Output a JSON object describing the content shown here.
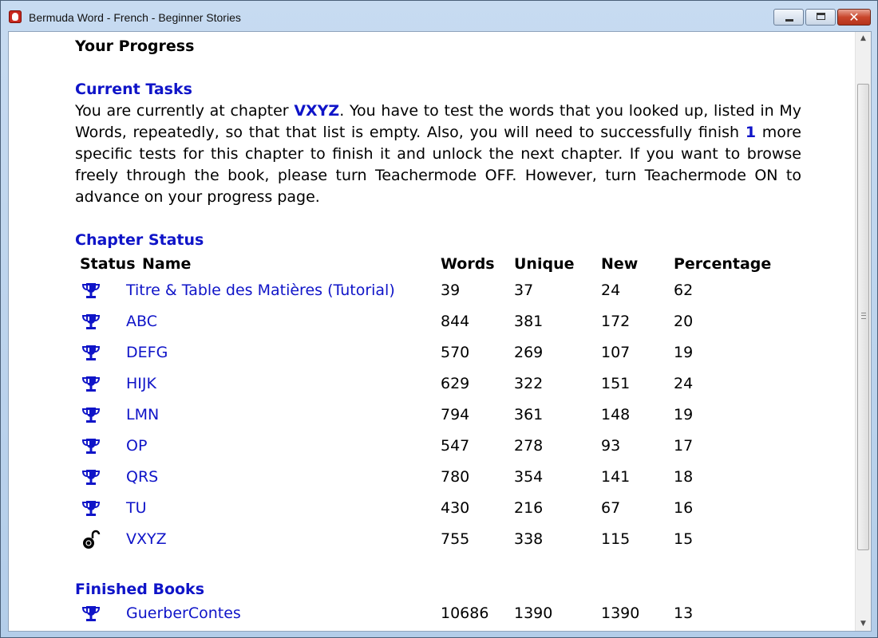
{
  "window": {
    "title": "Bermuda Word - French - Beginner Stories",
    "controls": {
      "minimize": "minimize",
      "maximize": "maximize",
      "close": "✕"
    }
  },
  "page": {
    "title": "Your Progress",
    "current_tasks": {
      "heading": "Current Tasks",
      "text_1": "You are currently at chapter ",
      "chapter": "VXYZ",
      "text_2": ". You have to test the words that you looked up, listed in My Words, repeatedly, so that that list is empty. Also, you will need to successfully finish ",
      "tests_remaining": "1",
      "text_3": " more specific tests for this chapter to finish it and unlock the next chapter. If you want to browse freely through the book, please turn Teachermode OFF. However, turn Teachermode ON to advance on your progress page."
    },
    "chapter_status": {
      "heading": "Chapter Status",
      "columns": {
        "status": "Status",
        "name": "Name",
        "words": "Words",
        "unique": "Unique",
        "new": "New",
        "percentage": "Percentage"
      },
      "rows": [
        {
          "status_icon": "trophy-icon",
          "name": "Titre & Table des Matières (Tutorial)",
          "words": "39",
          "unique": "37",
          "new": "24",
          "percentage": "62"
        },
        {
          "status_icon": "trophy-icon",
          "name": "ABC",
          "words": "844",
          "unique": "381",
          "new": "172",
          "percentage": "20"
        },
        {
          "status_icon": "trophy-icon",
          "name": "DEFG",
          "words": "570",
          "unique": "269",
          "new": "107",
          "percentage": "19"
        },
        {
          "status_icon": "trophy-icon",
          "name": "HIJK",
          "words": "629",
          "unique": "322",
          "new": "151",
          "percentage": "24"
        },
        {
          "status_icon": "trophy-icon",
          "name": "LMN",
          "words": "794",
          "unique": "361",
          "new": "148",
          "percentage": "19"
        },
        {
          "status_icon": "trophy-icon",
          "name": "OP",
          "words": "547",
          "unique": "278",
          "new": "93",
          "percentage": "17"
        },
        {
          "status_icon": "trophy-icon",
          "name": "QRS",
          "words": "780",
          "unique": "354",
          "new": "141",
          "percentage": "18"
        },
        {
          "status_icon": "trophy-icon",
          "name": "TU",
          "words": "430",
          "unique": "216",
          "new": "67",
          "percentage": "16"
        },
        {
          "status_icon": "unlocked-padlock-icon",
          "name": "VXYZ",
          "words": "755",
          "unique": "338",
          "new": "115",
          "percentage": "15"
        }
      ]
    },
    "finished_books": {
      "heading": "Finished Books",
      "rows": [
        {
          "status_icon": "trophy-icon",
          "name": "GuerberContes",
          "words": "10686",
          "unique": "1390",
          "new": "1390",
          "percentage": "13"
        }
      ]
    }
  },
  "colors": {
    "link": "#0f14c8",
    "titlebar": "#b3cde9",
    "close_button": "#c9462c"
  }
}
